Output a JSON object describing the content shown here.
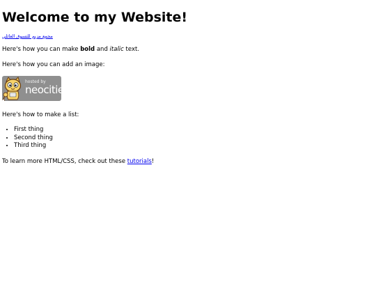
{
  "heading": "Welcome to my Website!",
  "arabic_link": "مجمع مزيم للتسوق العائلي",
  "bold_line": {
    "before": "Here's how you can make ",
    "bold": "bold",
    "middle": " and ",
    "italic": "italic",
    "after": " text."
  },
  "image_line": "Here's how you can add an image:",
  "badge": {
    "hosted_by": "hosted by",
    "brand": "neocities",
    "logo_icon": "neocities-cat-icon",
    "color": "#8f8f8f"
  },
  "list_intro": "Here's how to make a list:",
  "list_items": [
    "First thing",
    "Second thing",
    "Third thing"
  ],
  "learn_line": {
    "before": "To learn more HTML/CSS, check out these ",
    "link": "tutorials",
    "after": "!"
  },
  "link_color": "#0000ee"
}
